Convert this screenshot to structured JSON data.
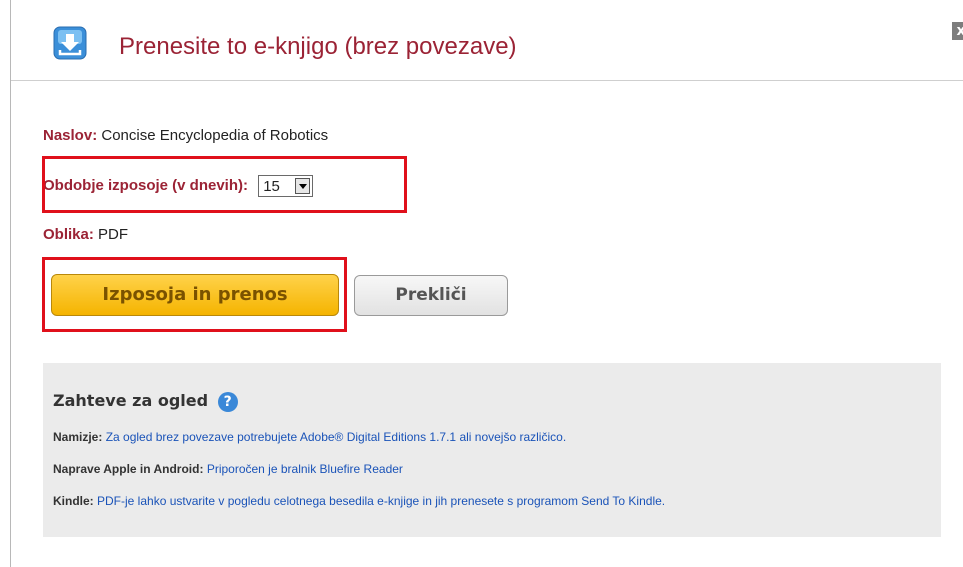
{
  "dialog": {
    "title": "Prenesite to e-knjigo (brez povezave)",
    "close_label": "x"
  },
  "details": {
    "title_label": "Naslov:",
    "title_value": "Concise Encyclopedia of Robotics",
    "period_label": "Obdobje izposoje (v dnevih):",
    "period_value": "15",
    "format_label": "Oblika:",
    "format_value": "PDF"
  },
  "buttons": {
    "borrow_label": "Izposoja in prenos",
    "cancel_label": "Prekliči"
  },
  "requirements": {
    "heading": "Zahteve za ogled",
    "help_glyph": "?",
    "desktop_label": "Namizje:",
    "desktop_text": "Za ogled brez povezave potrebujete Adobe® Digital Editions 1.7.1 ali novejšo različico.",
    "mobile_label": "Naprave Apple in Android:",
    "mobile_text": "Priporočen je bralnik Bluefire Reader",
    "kindle_label": "Kindle:",
    "kindle_text": "PDF-je lahko ustvarite v pogledu celotnega besedila e-knjige in jih prenesete s programom Send To Kindle."
  },
  "colors": {
    "accent": "#9b2335",
    "highlight": "#e0101b",
    "primary_button": "#f5b400",
    "link": "#1a53b8"
  },
  "icons": {
    "header": "download-icon",
    "help": "help-icon",
    "close": "close-icon"
  }
}
